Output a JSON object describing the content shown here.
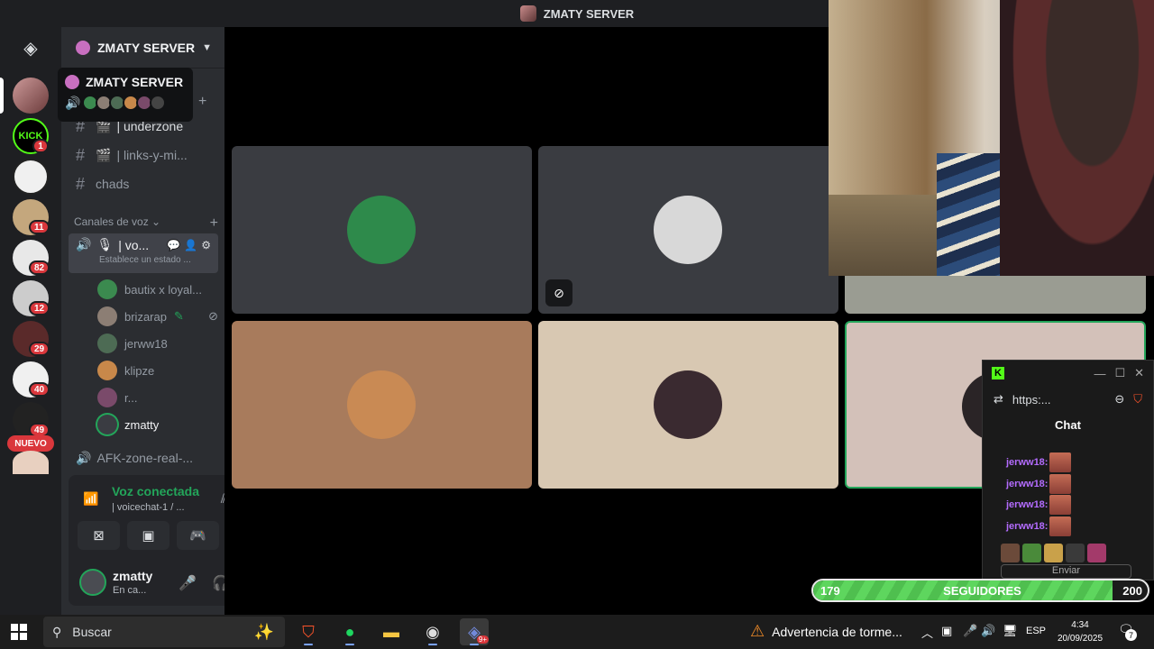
{
  "window": {
    "title": "ZMATY SERVER"
  },
  "rail": {
    "badges": [
      "1",
      "11",
      "82",
      "12",
      "29",
      "40",
      "49"
    ],
    "nuevo_label": "NUEVO"
  },
  "guild": {
    "name": "ZMATY SERVER"
  },
  "tooltip": {
    "title": "ZMATY SERVER"
  },
  "channels": {
    "text": [
      {
        "name": "| underzone"
      },
      {
        "name": "| links-y-mi..."
      },
      {
        "name": "chads"
      }
    ],
    "voice_category": "Canales de voz",
    "active_voice": {
      "name": "| vo...",
      "status": "Establece un estado ..."
    },
    "voice_users": [
      {
        "name": "bautix x loyal...",
        "color": "#3b8a4f"
      },
      {
        "name": "brizarap",
        "color": "#8c7e74"
      },
      {
        "name": "jerww18",
        "color": "#4d6b54"
      },
      {
        "name": "klipze",
        "color": "#c8884a"
      },
      {
        "name": "r...",
        "color": "#7a4a6a"
      },
      {
        "name": "zmatty",
        "color": "#3a3c42"
      }
    ],
    "afk": "AFK-zone-real-..."
  },
  "voice_panel": {
    "status": "Voz conectada",
    "channel": "| voicechat-1 / ...",
    "user": {
      "name": "zmatty",
      "status": "En ca..."
    }
  },
  "tiles": [
    {
      "bg": "#3a3c41",
      "avatar": "#2e8a4b"
    },
    {
      "bg": "#3a3c41",
      "avatar": "#d8d8d8",
      "muted": true
    },
    {
      "bg": "#9a9c92"
    },
    {
      "bg": "#a87b5c",
      "avatar": "#c98a54"
    },
    {
      "bg": "#d8c8b2",
      "avatar": "#3a2a30"
    },
    {
      "bg": "#d3c1b9",
      "avatar": "#2a2426"
    }
  ],
  "kick_chat": {
    "url": "https:...",
    "title": "Chat",
    "messages": [
      {
        "user": "jerww18:"
      },
      {
        "user": "jerww18:"
      },
      {
        "user": "jerww18:"
      },
      {
        "user": "jerww18:"
      }
    ],
    "send_label": "Enviar"
  },
  "followers": {
    "current": 179,
    "label": "SEGUIDORES",
    "goal": 200
  },
  "taskbar": {
    "search_placeholder": "Buscar",
    "weather": "Advertencia de torme...",
    "lang": "ESP",
    "time": "4:34",
    "date": "20/09/2025",
    "notifications": "7",
    "discord_badge": "9+"
  },
  "colors": {
    "accent_green": "#23a55a",
    "badge_red": "#da373c",
    "kick_green": "#53fc18",
    "chat_user": "#b46cff"
  }
}
